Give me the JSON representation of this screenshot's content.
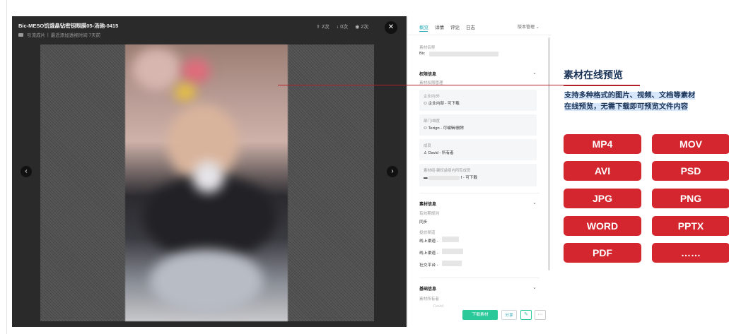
{
  "viewer": {
    "title": "Bic-MESO饥饿晶钻密钥眼膜05-汤驰-0415",
    "folder": "引流成片",
    "recent": "最近添加透视时间 7天前",
    "stats": {
      "share": "2次",
      "download": "0次",
      "view": "2次"
    },
    "close_glyph": "✕",
    "prev_glyph": "‹",
    "next_glyph": "›"
  },
  "panel": {
    "tabs": [
      "概览",
      "详情",
      "评论",
      "日志"
    ],
    "version": "版本管理 ⌄",
    "asset_name_label": "素材名称",
    "asset_name_value": "Bic",
    "permission_section": "权限信息",
    "permission_sub": "素材权限管理",
    "cards": [
      {
        "label": "企业内/外",
        "value": "企业内部 - 可下载"
      },
      {
        "label": "部门/维度",
        "value": "Tezign - 可编辑/删除"
      },
      {
        "label": "成员",
        "value": "David - 所有者"
      },
      {
        "label": "素材组-聚权益组内所有成员",
        "value": "f - 可下载"
      }
    ],
    "info_section": "素材信息",
    "valid_label": "有效期规则",
    "valid_value": "同步",
    "channel_label": "投放渠道",
    "channels": [
      "线上渠道 -",
      "线上渠道 -",
      "社交平台 -"
    ],
    "basic_section": "基础信息",
    "owner_label": "素材所有者",
    "owner_value": "David",
    "download_btn": "下载素材",
    "share_btn": "分享",
    "edit_glyph": "✎",
    "more_glyph": "···"
  },
  "annotation": {
    "title": "素材在线预览",
    "desc_line1": "支持多种格式的图片、视频、文档等素材",
    "desc_line2": "在线预览，无需下载即可预览文件内容",
    "formats": [
      "MP4",
      "MOV",
      "AVI",
      "PSD",
      "JPG",
      "PNG",
      "WORD",
      "PPTX",
      "PDF",
      "……"
    ]
  },
  "colors": {
    "accent": "#d3262e",
    "teal": "#2aa9b8",
    "green": "#2bc89a",
    "navy": "#1b3457"
  }
}
